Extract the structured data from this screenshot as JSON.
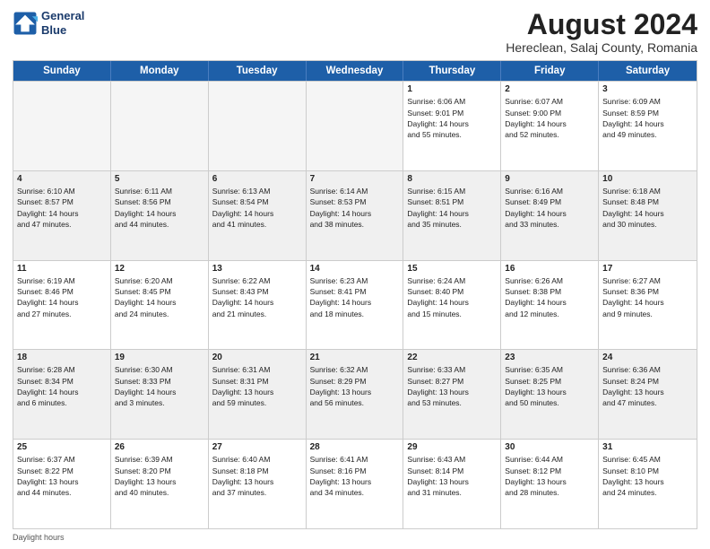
{
  "logo": {
    "line1": "General",
    "line2": "Blue"
  },
  "title": "August 2024",
  "subtitle": "Hereclean, Salaj County, Romania",
  "header": {
    "days": [
      "Sunday",
      "Monday",
      "Tuesday",
      "Wednesday",
      "Thursday",
      "Friday",
      "Saturday"
    ]
  },
  "footer": "Daylight hours",
  "rows": [
    {
      "cells": [
        {
          "day": "",
          "empty": true
        },
        {
          "day": "",
          "empty": true
        },
        {
          "day": "",
          "empty": true
        },
        {
          "day": "",
          "empty": true
        },
        {
          "day": "1",
          "info": "Sunrise: 6:06 AM\nSunset: 9:01 PM\nDaylight: 14 hours\nand 55 minutes."
        },
        {
          "day": "2",
          "info": "Sunrise: 6:07 AM\nSunset: 9:00 PM\nDaylight: 14 hours\nand 52 minutes."
        },
        {
          "day": "3",
          "info": "Sunrise: 6:09 AM\nSunset: 8:59 PM\nDaylight: 14 hours\nand 49 minutes."
        }
      ]
    },
    {
      "cells": [
        {
          "day": "4",
          "info": "Sunrise: 6:10 AM\nSunset: 8:57 PM\nDaylight: 14 hours\nand 47 minutes."
        },
        {
          "day": "5",
          "info": "Sunrise: 6:11 AM\nSunset: 8:56 PM\nDaylight: 14 hours\nand 44 minutes."
        },
        {
          "day": "6",
          "info": "Sunrise: 6:13 AM\nSunset: 8:54 PM\nDaylight: 14 hours\nand 41 minutes."
        },
        {
          "day": "7",
          "info": "Sunrise: 6:14 AM\nSunset: 8:53 PM\nDaylight: 14 hours\nand 38 minutes."
        },
        {
          "day": "8",
          "info": "Sunrise: 6:15 AM\nSunset: 8:51 PM\nDaylight: 14 hours\nand 35 minutes."
        },
        {
          "day": "9",
          "info": "Sunrise: 6:16 AM\nSunset: 8:49 PM\nDaylight: 14 hours\nand 33 minutes."
        },
        {
          "day": "10",
          "info": "Sunrise: 6:18 AM\nSunset: 8:48 PM\nDaylight: 14 hours\nand 30 minutes."
        }
      ]
    },
    {
      "cells": [
        {
          "day": "11",
          "info": "Sunrise: 6:19 AM\nSunset: 8:46 PM\nDaylight: 14 hours\nand 27 minutes."
        },
        {
          "day": "12",
          "info": "Sunrise: 6:20 AM\nSunset: 8:45 PM\nDaylight: 14 hours\nand 24 minutes."
        },
        {
          "day": "13",
          "info": "Sunrise: 6:22 AM\nSunset: 8:43 PM\nDaylight: 14 hours\nand 21 minutes."
        },
        {
          "day": "14",
          "info": "Sunrise: 6:23 AM\nSunset: 8:41 PM\nDaylight: 14 hours\nand 18 minutes."
        },
        {
          "day": "15",
          "info": "Sunrise: 6:24 AM\nSunset: 8:40 PM\nDaylight: 14 hours\nand 15 minutes."
        },
        {
          "day": "16",
          "info": "Sunrise: 6:26 AM\nSunset: 8:38 PM\nDaylight: 14 hours\nand 12 minutes."
        },
        {
          "day": "17",
          "info": "Sunrise: 6:27 AM\nSunset: 8:36 PM\nDaylight: 14 hours\nand 9 minutes."
        }
      ]
    },
    {
      "cells": [
        {
          "day": "18",
          "info": "Sunrise: 6:28 AM\nSunset: 8:34 PM\nDaylight: 14 hours\nand 6 minutes."
        },
        {
          "day": "19",
          "info": "Sunrise: 6:30 AM\nSunset: 8:33 PM\nDaylight: 14 hours\nand 3 minutes."
        },
        {
          "day": "20",
          "info": "Sunrise: 6:31 AM\nSunset: 8:31 PM\nDaylight: 13 hours\nand 59 minutes."
        },
        {
          "day": "21",
          "info": "Sunrise: 6:32 AM\nSunset: 8:29 PM\nDaylight: 13 hours\nand 56 minutes."
        },
        {
          "day": "22",
          "info": "Sunrise: 6:33 AM\nSunset: 8:27 PM\nDaylight: 13 hours\nand 53 minutes."
        },
        {
          "day": "23",
          "info": "Sunrise: 6:35 AM\nSunset: 8:25 PM\nDaylight: 13 hours\nand 50 minutes."
        },
        {
          "day": "24",
          "info": "Sunrise: 6:36 AM\nSunset: 8:24 PM\nDaylight: 13 hours\nand 47 minutes."
        }
      ]
    },
    {
      "cells": [
        {
          "day": "25",
          "info": "Sunrise: 6:37 AM\nSunset: 8:22 PM\nDaylight: 13 hours\nand 44 minutes."
        },
        {
          "day": "26",
          "info": "Sunrise: 6:39 AM\nSunset: 8:20 PM\nDaylight: 13 hours\nand 40 minutes."
        },
        {
          "day": "27",
          "info": "Sunrise: 6:40 AM\nSunset: 8:18 PM\nDaylight: 13 hours\nand 37 minutes."
        },
        {
          "day": "28",
          "info": "Sunrise: 6:41 AM\nSunset: 8:16 PM\nDaylight: 13 hours\nand 34 minutes."
        },
        {
          "day": "29",
          "info": "Sunrise: 6:43 AM\nSunset: 8:14 PM\nDaylight: 13 hours\nand 31 minutes."
        },
        {
          "day": "30",
          "info": "Sunrise: 6:44 AM\nSunset: 8:12 PM\nDaylight: 13 hours\nand 28 minutes."
        },
        {
          "day": "31",
          "info": "Sunrise: 6:45 AM\nSunset: 8:10 PM\nDaylight: 13 hours\nand 24 minutes."
        }
      ]
    }
  ]
}
